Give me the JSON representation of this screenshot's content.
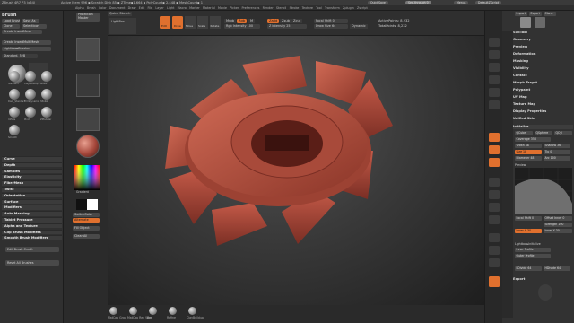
{
  "titlebar": {
    "app": "ZBrush 4R7 P3 (x64)",
    "scene": "Active Mem 996 ▪ Scratch Disk 85 ▪ ZTime▪1.664 ▪ PolyCount▪ 2.448 ▪ MeshCount▪ 1",
    "quicksave": "QuickSave",
    "seethrough": "See-through 0",
    "menus": "Menus",
    "defaultscript": "DefaultZScript"
  },
  "menubar": {
    "items": [
      "Alpha",
      "Brush",
      "Color",
      "Document",
      "Draw",
      "Edit",
      "File",
      "Layer",
      "Light",
      "Macro",
      "Marker",
      "Material",
      "Movie",
      "Picker",
      "Preferences",
      "Render",
      "Stencil",
      "Stroke",
      "Texture",
      "Tool",
      "Transform",
      "Zplugin",
      "Zscript"
    ]
  },
  "leftpanel": {
    "title": "Brush",
    "buttons": {
      "load_brush": "Load Brush",
      "save_as": "Save As",
      "clone": "Clone",
      "select_icon": "SelectIcon",
      "create_insertmesh": "Create InsertMesh",
      "create_insertmultimesh": "Create InsertMultiMesh",
      "lightbox_brushes": "Lightbox▸Brushes",
      "standard": "Standard. 52B",
      "add_brush_to_rail": "Edit Brush Credit",
      "reset_all_brushes": "Reset All Brushes"
    },
    "brush_labels": [
      "Standard",
      "ClayBuildup",
      "Move",
      "Dam_Standard",
      "TrimDynamic",
      "hPolish",
      "Inflate",
      "Pinch",
      "ZModeler",
      "Smooth"
    ],
    "sections": [
      "Curve",
      "Depth",
      "Samples",
      "Elasticity",
      "FiberMesh",
      "Twist",
      "Orientation",
      "Surface",
      "Modifiers",
      "Auto Masking",
      "Tablet Pressure",
      "Alpha and Texture",
      "Clip Brush Modifiers",
      "Smooth Brush Modifiers"
    ]
  },
  "toolcol": {
    "projection_master": "Projection Master",
    "lightbox": "LightBox",
    "gradient": "Gradient",
    "switchcolor": "SwitchColor",
    "alternate": "Alternate",
    "fill_object": "Fill Object",
    "clear_all": "Clear All"
  },
  "topshelf": {
    "quick_sketch": "Quick Sketch",
    "edit": "Edit",
    "draw": "Draw",
    "move": "Move",
    "scale": "Scale",
    "rotate": "Rotate",
    "mrgb": "Mrgb",
    "rgb": "Rgb",
    "m": "M",
    "rgb_intensity": "Rgb Intensity 100",
    "zadd": "Zadd",
    "zsub": "Zsub",
    "zcut": "Zcut",
    "z_intensity": "Z Intensity 25",
    "focal_shift": "Focal Shift 0",
    "draw_size": "Draw Size 64",
    "dynamic": "Dynamic",
    "active_points": "ActivePoints: 8,232",
    "total_points": "TotalPoints: 8,232"
  },
  "bottomshelf": {
    "brushes": [
      "MatCap Gray",
      "MatCap Red Wax",
      "Bas",
      "Refine",
      "ClayBuildup"
    ]
  },
  "rightpanel": {
    "top_buttons": [
      "Import",
      "Export",
      "Clone",
      "Make PolyMesh3D",
      "GoZ",
      "All",
      "Visible",
      "R"
    ],
    "sections_top": [
      "Lightbox▸Tools",
      "Subtool",
      "Geometry",
      "ArrayMesh",
      "NanoMesh",
      "Layers",
      "FiberMesh",
      "Geometry HD",
      "Preview",
      "Surface",
      "Deformation",
      "Masking",
      "Visibility",
      "Polygroups",
      "Contact",
      "Morph Target",
      "Polypaint",
      "UV Map",
      "Texture Map",
      "Displacement Map",
      "Normal Map",
      "Vector Displacement Map",
      "Display Properties",
      "Unified Skin",
      "Initialize",
      "Import",
      "Export"
    ],
    "visible_sections": [
      "SubTool",
      "Geometry",
      "Preview",
      "Deformation",
      "Masking",
      "Visibility",
      "Contact",
      "Morph Target",
      "Polypaint",
      "UV Map",
      "Texture Map",
      "Display Properties",
      "Unified Skin",
      "Initialize"
    ],
    "init_header": "Initialize",
    "controls": {
      "qcube": "QCube",
      "qsphere": "QSphere",
      "qcyl": "QCyl",
      "coverage": "Coverage 358",
      "width": "Width 48",
      "shadow": "Shadow 36",
      "size": "Size 18",
      "tip": "Tip 0",
      "diameter": "Diameter 48",
      "arc": "Arc 100",
      "preview_label": "Preview",
      "focal_shift": "Focal Shift 0",
      "offset": "Offset Inner 0",
      "strength": "Strength 100",
      "lightbox_label": "Lightbox▸Initialize",
      "inner_x": "Inner X 30",
      "inner_y": "Inner Y 30",
      "inner_profile": "Inner Profile",
      "outer_profile": "Outer Profile",
      "ldivide": "LDivide 64",
      "hdivide": "HDivide 64",
      "export": "Export"
    }
  },
  "colors": {
    "accent": "#e0702e",
    "object": "#b04a3c",
    "panel": "#323232",
    "viewport_center": "#565656"
  }
}
